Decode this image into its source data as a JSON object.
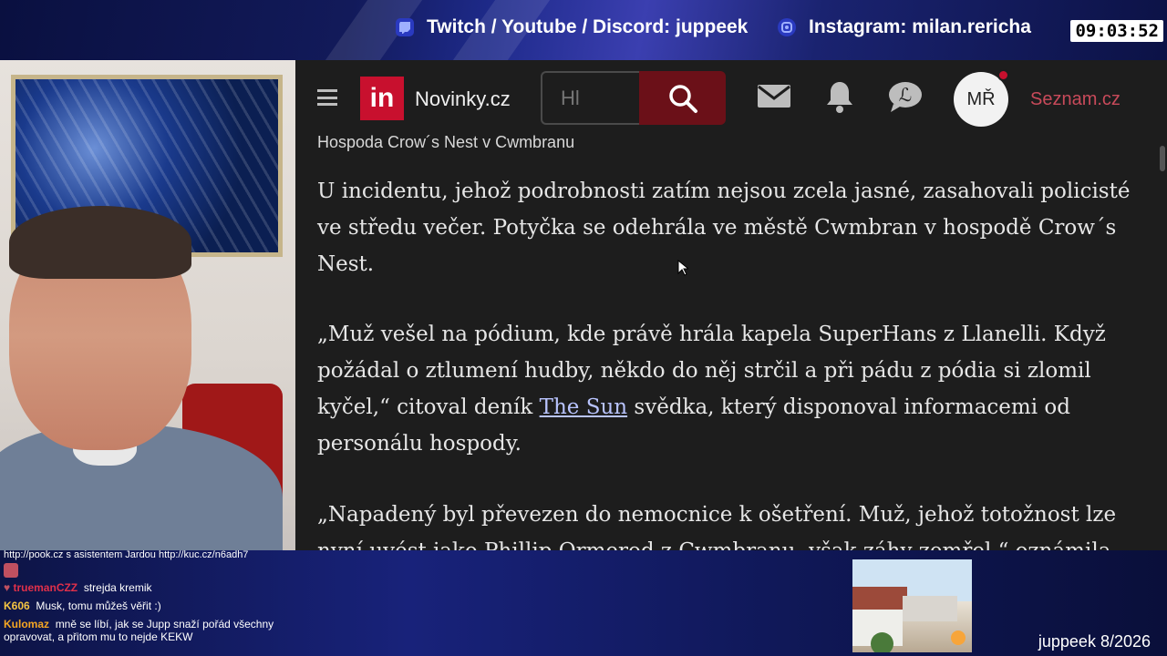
{
  "stream": {
    "socials": [
      {
        "icon": "twitch-icon",
        "label": "Twitch / Youtube / Discord: juppeek"
      },
      {
        "icon": "instagram-icon",
        "label": "Instagram: milan.rericha"
      }
    ],
    "clock": "09:03:52",
    "watermark": "juppeek 8/2026"
  },
  "browser": {
    "logo_text": "in",
    "site_name": "Novinky.cz",
    "search_placeholder": "Hl",
    "avatar_initials": "MŘ",
    "seznam_label": "Seznam.cz",
    "icons": [
      "menu-icon",
      "search-icon",
      "mail-icon",
      "bell-icon",
      "chat-icon"
    ]
  },
  "article": {
    "caption": "Hospoda Crow´s Nest v Cwmbranu",
    "p1": "U incidentu, jehož podrobnosti zatím nejsou zcela jasné, zasahovali policisté ve středu večer. Potyčka se odehrála ve městě Cwmbran v hospodě Crow´s Nest.",
    "p2_a": "„Muž vešel na pódium, kde právě hrála kapela SuperHans z Llanelli. Když požádal o ztlumení hudby, někdo do něj strčil a při pádu z pódia si zlomil kyčel,“ citoval deník ",
    "p2_link": "The Sun",
    "p2_b": " svědka, který disponoval informacemi od personálu hospody.",
    "p3": "„Napadený byl převezen do nemocnice k ošetření. Muž, jehož totožnost lze nyní uvést jako Phillip Ormerod z Cwmbranu, však záhy zemřel,“ oznámila"
  },
  "chat": {
    "header": "http://pook.cz s asistentem Jardou http://kuc.cz/n6adh7",
    "messages": [
      {
        "user": "truemanCZZ",
        "user_color": "#e0304a",
        "text": "strejda kremik"
      },
      {
        "user": "K606",
        "user_color": "#f5c542",
        "text": "Musk, tomu můžeš věřit :)"
      },
      {
        "user": "Kulomaz",
        "user_color": "#f5a623",
        "text": "mně se líbí, jak se Jupp snaží pořád všechny opravovat, a přitom mu to nejde KEKW"
      }
    ]
  },
  "colors": {
    "brand_red": "#c8102e",
    "search_btn": "#6b1018",
    "link": "#b9c4ff"
  }
}
